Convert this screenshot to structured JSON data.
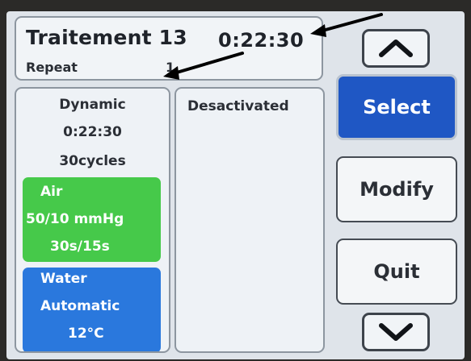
{
  "header": {
    "title": "Traitement 13",
    "time": "0:22:30",
    "mode": "Repeat",
    "count": "1"
  },
  "program": {
    "type": "Dynamic",
    "duration": "0:22:30",
    "cycles": "30cycles",
    "air": {
      "label": "Air",
      "pressure": "50/10 mmHg",
      "timing": "30s/15s",
      "color": "#46c94a"
    },
    "water": {
      "label": "Water",
      "mode": "Automatic",
      "temperature": "12°C",
      "color": "#2a78dd"
    }
  },
  "second_slot": {
    "status": "Desactivated"
  },
  "buttons": {
    "select": "Select",
    "modify": "Modify",
    "quit": "Quit",
    "select_color": "#1f57c4"
  },
  "icons": {
    "scroll_up": "chevron-up-icon",
    "scroll_down": "chevron-down-icon",
    "annotation": "arrow-icon"
  }
}
